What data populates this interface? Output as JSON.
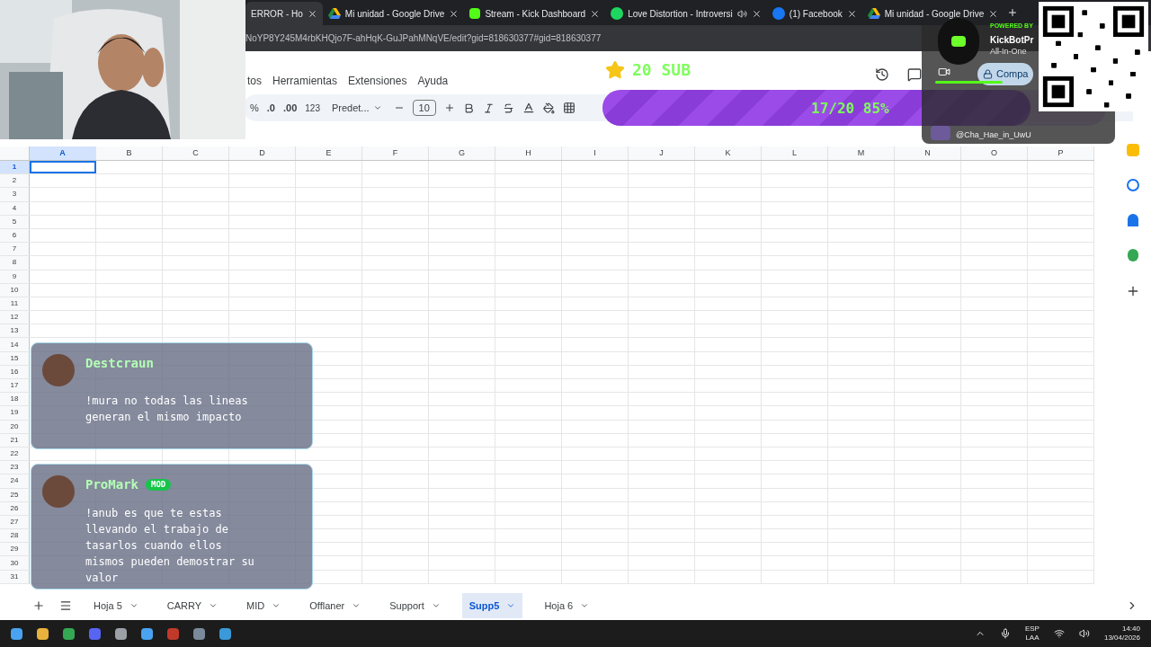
{
  "browser_tabs": [
    {
      "title": "ERROR - Ho",
      "selected": true
    },
    {
      "title": "Mi unidad - Google Drive",
      "kind": "drive",
      "selected": false
    },
    {
      "title": "Stream - Kick Dashboard",
      "kind": "kick",
      "selected": false
    },
    {
      "title": "Love Distortion - Introversi",
      "kind": "spotify",
      "selected": false,
      "audio": true
    },
    {
      "title": "(1) Facebook",
      "kind": "facebook",
      "selected": false
    },
    {
      "title": "Mi unidad - Google Drive",
      "kind": "drive",
      "selected": false
    }
  ],
  "address": "NoYP8Y245M4rbKHQjo7F-ahHqK-GuJPahMNqVE/edit?gid=818630377#gid=818630377",
  "menu": [
    "tos",
    "Herramientas",
    "Extensiones",
    "Ayuda"
  ],
  "toolbar": {
    "percent": "%",
    "dec_less": ".0",
    "dec_more": ".00",
    "format": "123",
    "font": "Predet...",
    "size": "10"
  },
  "columns": [
    {
      "label": "A",
      "selected": true
    },
    {
      "label": "B",
      "selected": false
    },
    {
      "label": "C",
      "selected": false
    },
    {
      "label": "D",
      "selected": false
    },
    {
      "label": "E",
      "selected": false
    },
    {
      "label": "F",
      "selected": false
    },
    {
      "label": "G",
      "selected": false
    },
    {
      "label": "H",
      "selected": false
    },
    {
      "label": "I",
      "selected": false
    },
    {
      "label": "J",
      "selected": false
    },
    {
      "label": "K",
      "selected": false
    },
    {
      "label": "L",
      "selected": false
    },
    {
      "label": "M",
      "selected": false
    },
    {
      "label": "N",
      "selected": false
    },
    {
      "label": "O",
      "selected": false
    },
    {
      "label": "P",
      "selected": false
    }
  ],
  "rows": [
    {
      "label": "1",
      "selected": true
    },
    {
      "label": "2",
      "selected": false
    },
    {
      "label": "3",
      "selected": false
    },
    {
      "label": "4",
      "selected": false
    },
    {
      "label": "5",
      "selected": false
    },
    {
      "label": "6",
      "selected": false
    },
    {
      "label": "7",
      "selected": false
    },
    {
      "label": "8",
      "selected": false
    },
    {
      "label": "9",
      "selected": false
    },
    {
      "label": "10",
      "selected": false
    },
    {
      "label": "11",
      "selected": false
    },
    {
      "label": "12",
      "selected": false
    },
    {
      "label": "13",
      "selected": false
    },
    {
      "label": "14",
      "selected": false
    },
    {
      "label": "15",
      "selected": false
    },
    {
      "label": "16",
      "selected": false
    },
    {
      "label": "17",
      "selected": false
    },
    {
      "label": "18",
      "selected": false
    },
    {
      "label": "19",
      "selected": false
    },
    {
      "label": "20",
      "selected": false
    },
    {
      "label": "21",
      "selected": false
    },
    {
      "label": "22",
      "selected": false
    },
    {
      "label": "23",
      "selected": false
    },
    {
      "label": "24",
      "selected": false
    },
    {
      "label": "25",
      "selected": false
    },
    {
      "label": "26",
      "selected": false
    },
    {
      "label": "27",
      "selected": false
    },
    {
      "label": "28",
      "selected": false
    },
    {
      "label": "29",
      "selected": false
    },
    {
      "label": "30",
      "selected": false
    },
    {
      "label": "31",
      "selected": false
    }
  ],
  "sheets": [
    {
      "name": "Hoja 5",
      "selected": false
    },
    {
      "name": "CARRY",
      "selected": false
    },
    {
      "name": "MID",
      "selected": false
    },
    {
      "name": "Offlaner",
      "selected": false
    },
    {
      "name": "Support",
      "selected": false
    },
    {
      "name": "Supp5",
      "selected": true
    },
    {
      "name": "Hoja 6",
      "selected": false
    }
  ],
  "taskbar": {
    "lang": "ESP",
    "layout": "LAA",
    "time": "14:40",
    "date": "13/04/2026"
  },
  "overlay": {
    "sub_goal": "20 SUB",
    "progress": {
      "text": "17/20 85%",
      "level": 0.85
    },
    "kickbot": {
      "powered": "POWERED BY",
      "name": "KickBotPr",
      "tagline": "All-In-One",
      "share": "Compa",
      "viewer": "@Cha_Hae_in_UwU"
    },
    "chat": [
      {
        "user": "Destcraun",
        "text": "!mura no todas las lineas generan el mismo impacto"
      },
      {
        "user": "ProMark",
        "badge": "MOD",
        "text": "!anub es que te estas llevando el trabajo de tasarlos cuando ellos mismos pueden demostrar su valor"
      }
    ]
  }
}
